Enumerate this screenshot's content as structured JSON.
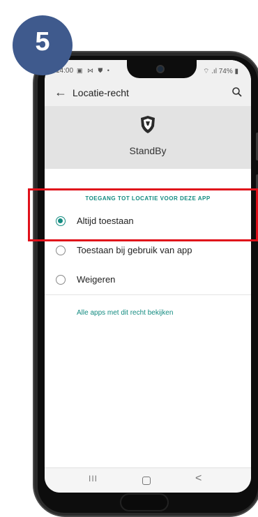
{
  "step": {
    "number": "5"
  },
  "status_bar": {
    "time": "14:00",
    "left_icons": "▣ ⋈ ⛊ •",
    "right": "⌔ .ıl 74% ▮"
  },
  "toolbar": {
    "title": "Locatie-recht"
  },
  "app": {
    "name": "StandBy"
  },
  "section": {
    "title": "TOEGANG TOT LOCATIE VOOR DEZE APP"
  },
  "options": [
    {
      "label": "Altijd toestaan",
      "selected": true
    },
    {
      "label": "Toestaan bij gebruik van app",
      "selected": false
    },
    {
      "label": "Weigeren",
      "selected": false
    }
  ],
  "link": {
    "label": "Alle apps met dit recht bekijken"
  },
  "navbar": {
    "recent": "III",
    "back": "<"
  },
  "colors": {
    "accent": "#138b80",
    "badge": "#3f5a8d",
    "highlight": "#e0101a"
  }
}
